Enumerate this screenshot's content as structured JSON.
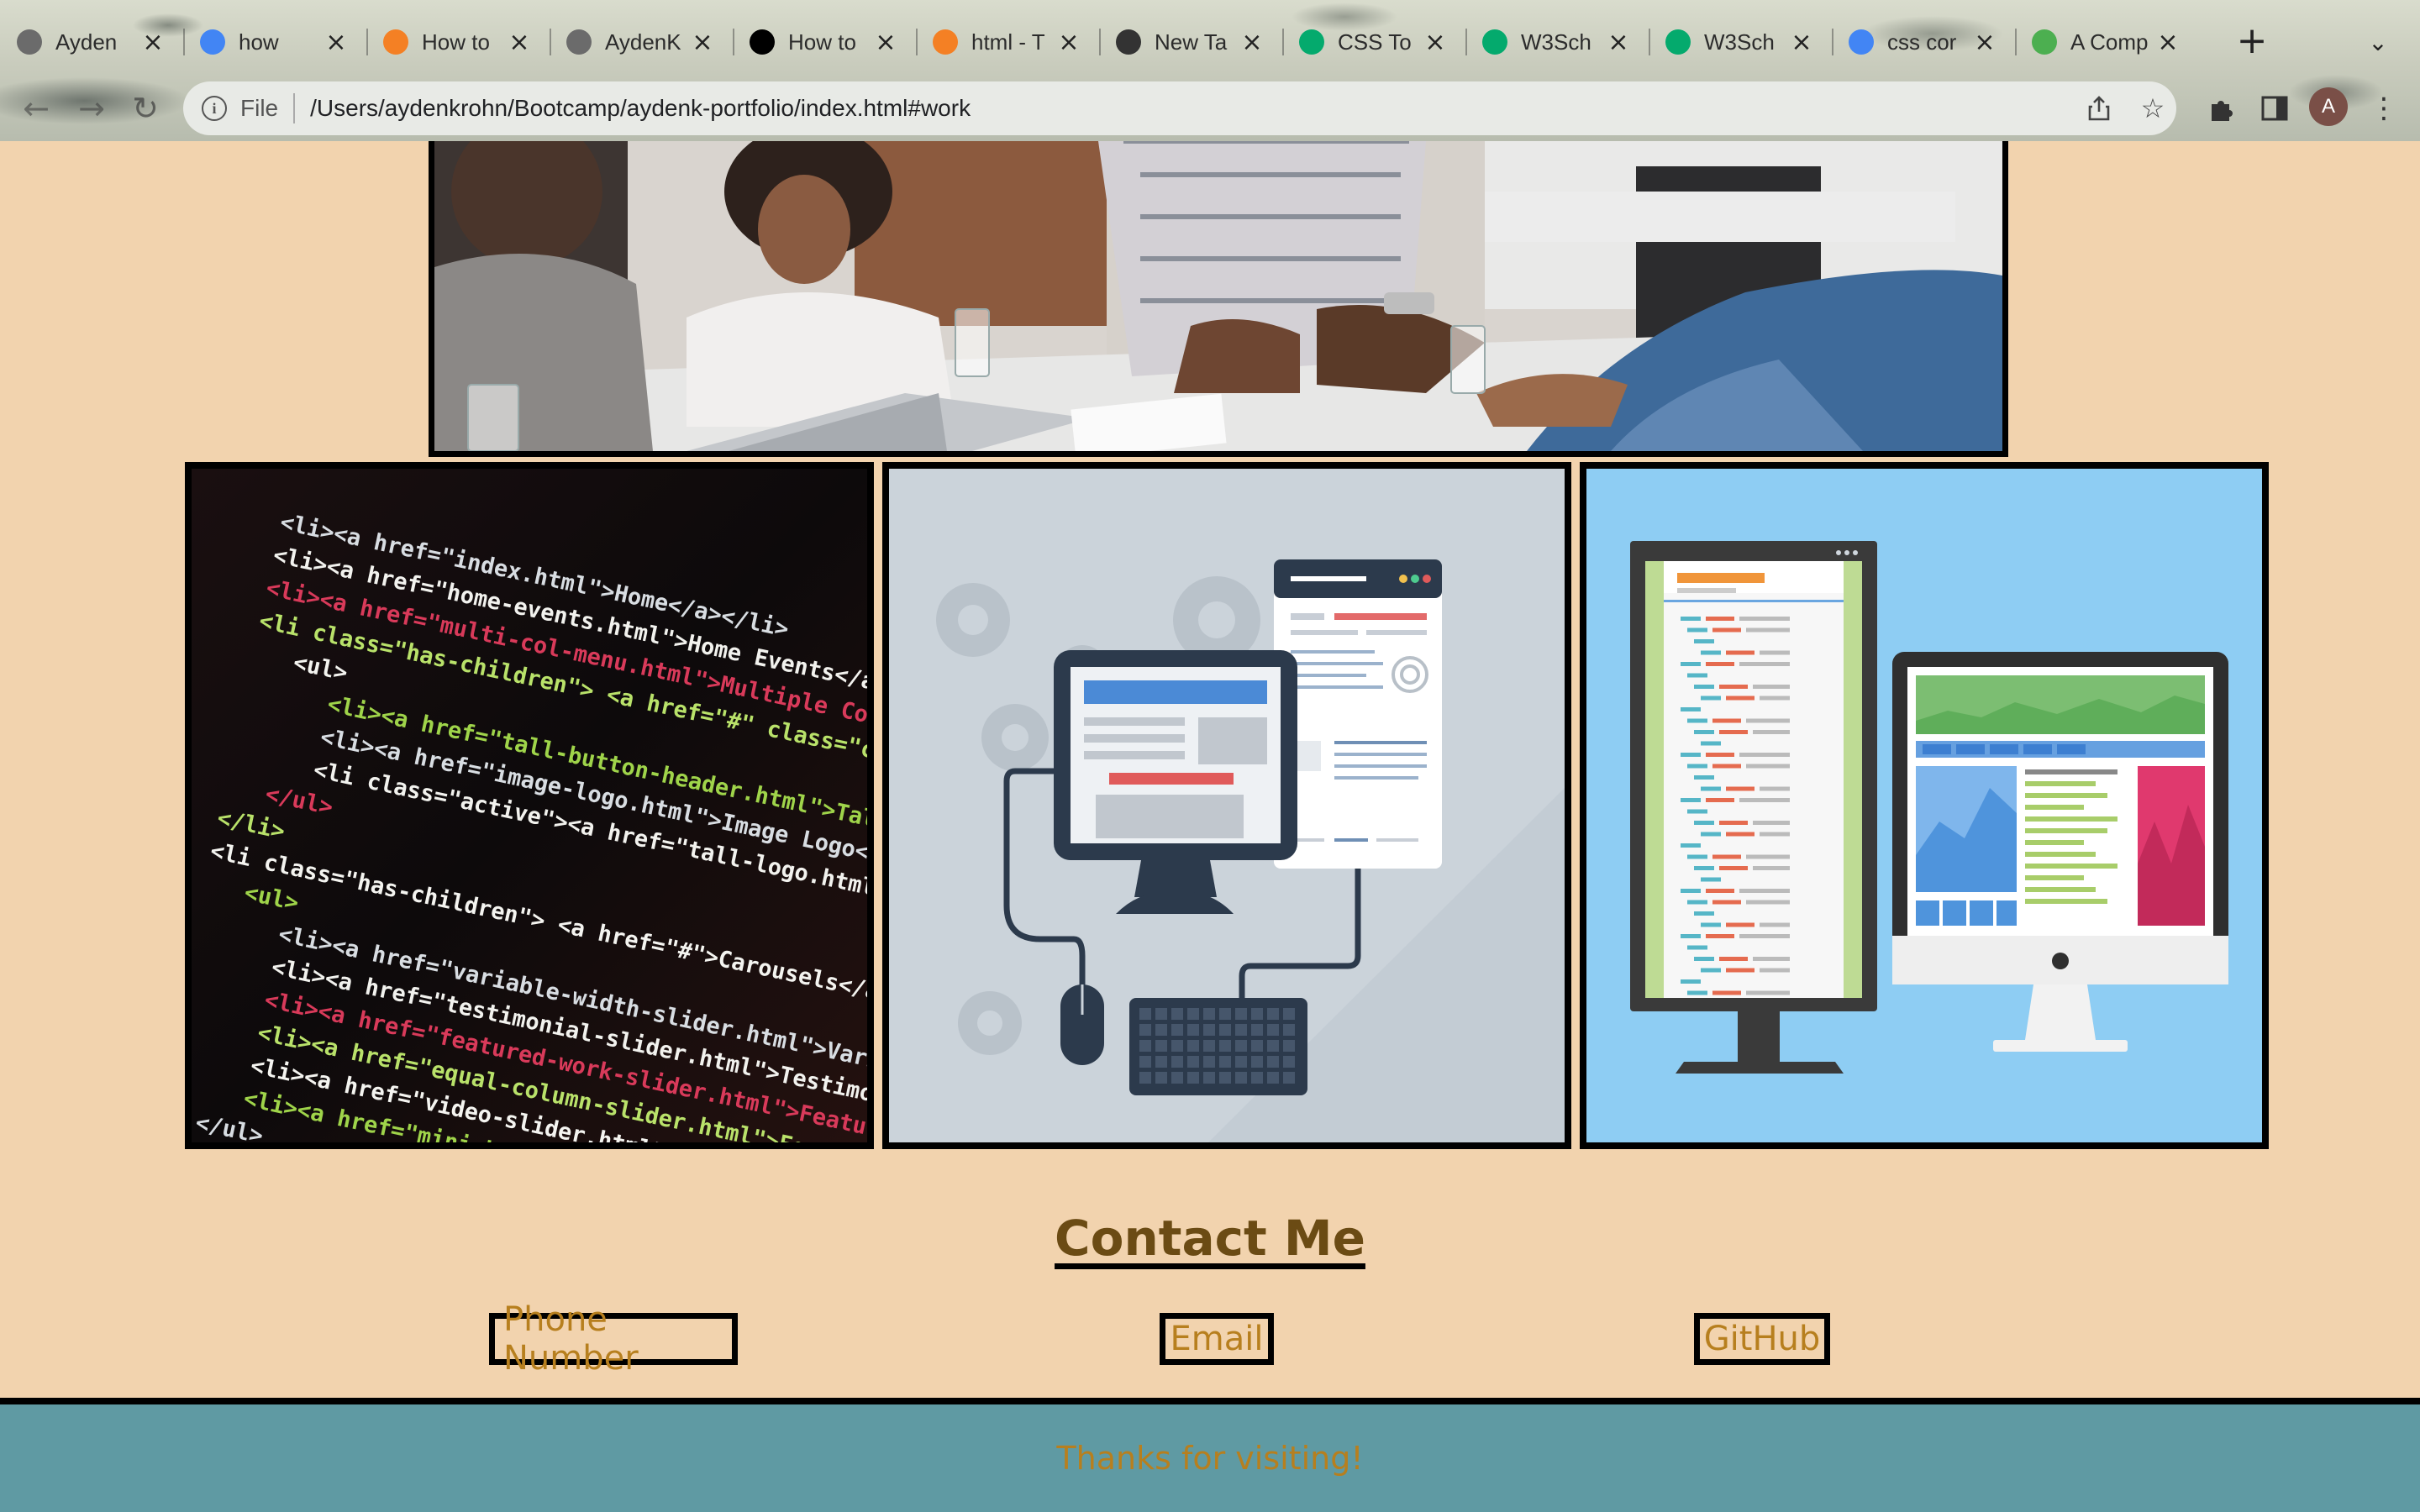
{
  "browser": {
    "tabs": [
      {
        "title": "Ayden",
        "favicon": "globe-icon",
        "color": "#6b6b6b"
      },
      {
        "title": "how",
        "favicon": "google-icon",
        "color": "#4285f4"
      },
      {
        "title": "How to",
        "favicon": "stackoverflow-icon",
        "color": "#f48024"
      },
      {
        "title": "AydenK",
        "favicon": "globe-icon",
        "color": "#6b6b6b"
      },
      {
        "title": "How to",
        "favicon": "dev-icon",
        "color": "#000000"
      },
      {
        "title": "html - T",
        "favicon": "stackoverflow-icon",
        "color": "#f48024"
      },
      {
        "title": "New Ta",
        "favicon": "chrome-icon",
        "color": "#333333"
      },
      {
        "title": "CSS To",
        "favicon": "w3schools-icon",
        "color": "#04aa6d"
      },
      {
        "title": "W3Sch",
        "favicon": "w3schools-icon",
        "color": "#04aa6d"
      },
      {
        "title": "W3Sch",
        "favicon": "w3schools-icon",
        "color": "#04aa6d"
      },
      {
        "title": "css cor",
        "favicon": "google-icon",
        "color": "#4285f4"
      },
      {
        "title": "A Comp",
        "favicon": "leaf-icon",
        "color": "#4caf50"
      }
    ],
    "new_tab_glyph": "+",
    "tab_search_glyph": "⌄",
    "url_scheme": "File",
    "url": "/Users/aydenkrohn/Bootcamp/aydenk-portfolio/index.html#work",
    "avatar_initial": "A"
  },
  "page": {
    "contact_heading": "Contact Me",
    "contact_links": [
      {
        "label": "Phone Number"
      },
      {
        "label": "Email"
      },
      {
        "label": "GitHub"
      }
    ],
    "footer_text": "Thanks for visiting!",
    "colors": {
      "background": "#f2d3ae",
      "link": "#b77f1e",
      "heading": "#6b4b14",
      "footer_bg": "#5f9aa3",
      "border": "#000000"
    }
  },
  "images": {
    "hero": "people-meeting-photo",
    "gallery": [
      "code-screen-photo",
      "computer-illustration",
      "dual-monitor-illustration"
    ]
  },
  "code_snippet": [
    {
      "indent": 0,
      "text": "<li><a href=\"index.html\">Home</a></li>"
    },
    {
      "indent": 0,
      "text": "<li><a href=\"home-events.html\">Home Events</a></li>"
    },
    {
      "indent": 0,
      "text": "<li><a href=\"multi-col-menu.html\">Multiple Column Menu on Larger Viewports</a></li>"
    },
    {
      "indent": 0,
      "text": "<li class=\"has-children\"> <a href=\"#\" class=\"current\">Header Options</a>"
    },
    {
      "indent": 1,
      "text": "<ul>"
    },
    {
      "indent": 2,
      "text": "<li><a href=\"tall-button-header.html\">Tall Button Header</a></li>"
    },
    {
      "indent": 2,
      "text": "<li><a href=\"image-logo.html\">Image Logo</a></li>"
    },
    {
      "indent": 2,
      "text": "<li class=\"active\"><a href=\"tall-logo.html\">Tall Logo Image</a></li>"
    },
    {
      "indent": 1,
      "text": "</ul>"
    },
    {
      "indent": 0,
      "text": "</li>"
    },
    {
      "indent": 0,
      "text": "<li class=\"has-children\"> <a href=\"#\">Carousels</a>"
    },
    {
      "indent": 1,
      "text": "<ul>"
    },
    {
      "indent": 2,
      "text": "<li><a href=\"variable-width-slider.html\">Variable Image Wi"
    },
    {
      "indent": 2,
      "text": "<li><a href=\"testimonial-slider.html\">Testimonial Slider</"
    },
    {
      "indent": 2,
      "text": "<li><a href=\"featured-work-slider.html\">Featured Work Sli"
    },
    {
      "indent": 2,
      "text": "<li><a href=\"equal-column-slider.html\">Equal Column Slid"
    },
    {
      "indent": 2,
      "text": "<li><a href=\"video-slider.html\">Video Slider</a></li>"
    },
    {
      "indent": 2,
      "text": "<li><a href=\"mini-bootstrap-carousel.html\">Mini Slider"
    },
    {
      "indent": 1,
      "text": "</ul>"
    }
  ]
}
